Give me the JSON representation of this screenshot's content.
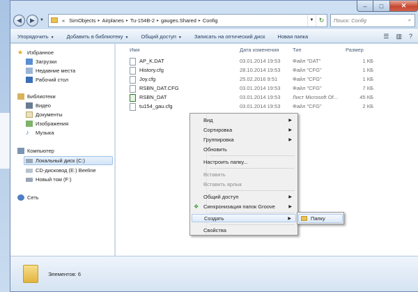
{
  "window": {
    "caption_minimize": "–",
    "caption_maximize": "□",
    "caption_close": "✕"
  },
  "address_bar": {
    "prefix": "«",
    "crumbs": [
      "SimObjects",
      "Airplanes",
      "Tu-154B-2",
      "gauges.Shared",
      "Config"
    ],
    "search_placeholder": "Поиск: Config"
  },
  "toolbar": {
    "organize": "Упорядочить",
    "add_to_library": "Добавить в библиотеку",
    "share": "Общий доступ",
    "burn": "Записать на оптический диск",
    "new_folder": "Новая папка"
  },
  "sidebar": {
    "favorites": "Избранное",
    "downloads": "Загрузки",
    "recent": "Недавние места",
    "desktop": "Рабочий стол",
    "libraries": "Библиотеки",
    "video": "Видео",
    "documents": "Документы",
    "pictures": "Изображения",
    "music": "Музыка",
    "computer": "Компьютер",
    "local_disk": "Локальный диск (C:)",
    "cd_drive": "CD-дисковод (E:) Beeline",
    "new_volume": "Новый том (F:)",
    "network": "Сеть"
  },
  "columns": {
    "name": "Имя",
    "date": "Дата изменения",
    "type": "Тип",
    "size": "Размер"
  },
  "files": [
    {
      "name": "AP_K.DAT",
      "date": "03.01.2014 19:53",
      "type": "Файл \"DAT\"",
      "size": "1 КБ"
    },
    {
      "name": "History.cfg",
      "date": "28.10.2014 19:53",
      "type": "Файл \"CFG\"",
      "size": "1 КБ"
    },
    {
      "name": "Joy.cfg",
      "date": "25.02.2016 9:51",
      "type": "Файл \"CFG\"",
      "size": "1 КБ"
    },
    {
      "name": "RSBN_DAT.CFG",
      "date": "03.01.2014 19:53",
      "type": "Файл \"CFG\"",
      "size": "7 КБ"
    },
    {
      "name": "RSBN_DAT",
      "date": "03.01.2014 19:53",
      "type": "Лист Microsoft Of...",
      "size": "45 КБ"
    },
    {
      "name": "tu154_gau.cfg",
      "date": "03.01.2014 19:53",
      "type": "Файл \"CFG\"",
      "size": "2 КБ"
    }
  ],
  "context_menu": {
    "view": "Вид",
    "sort": "Сортировка",
    "group": "Группировка",
    "refresh": "Обновить",
    "customize": "Настроить папку...",
    "paste": "Вставить",
    "paste_shortcut": "Вставить ярлык",
    "share": "Общий доступ",
    "groove_sync": "Синхронизация папок Groove",
    "create": "Создать",
    "properties": "Свойства"
  },
  "submenu": {
    "folder": "Папку"
  },
  "status": {
    "items": "Элементов: 6"
  }
}
